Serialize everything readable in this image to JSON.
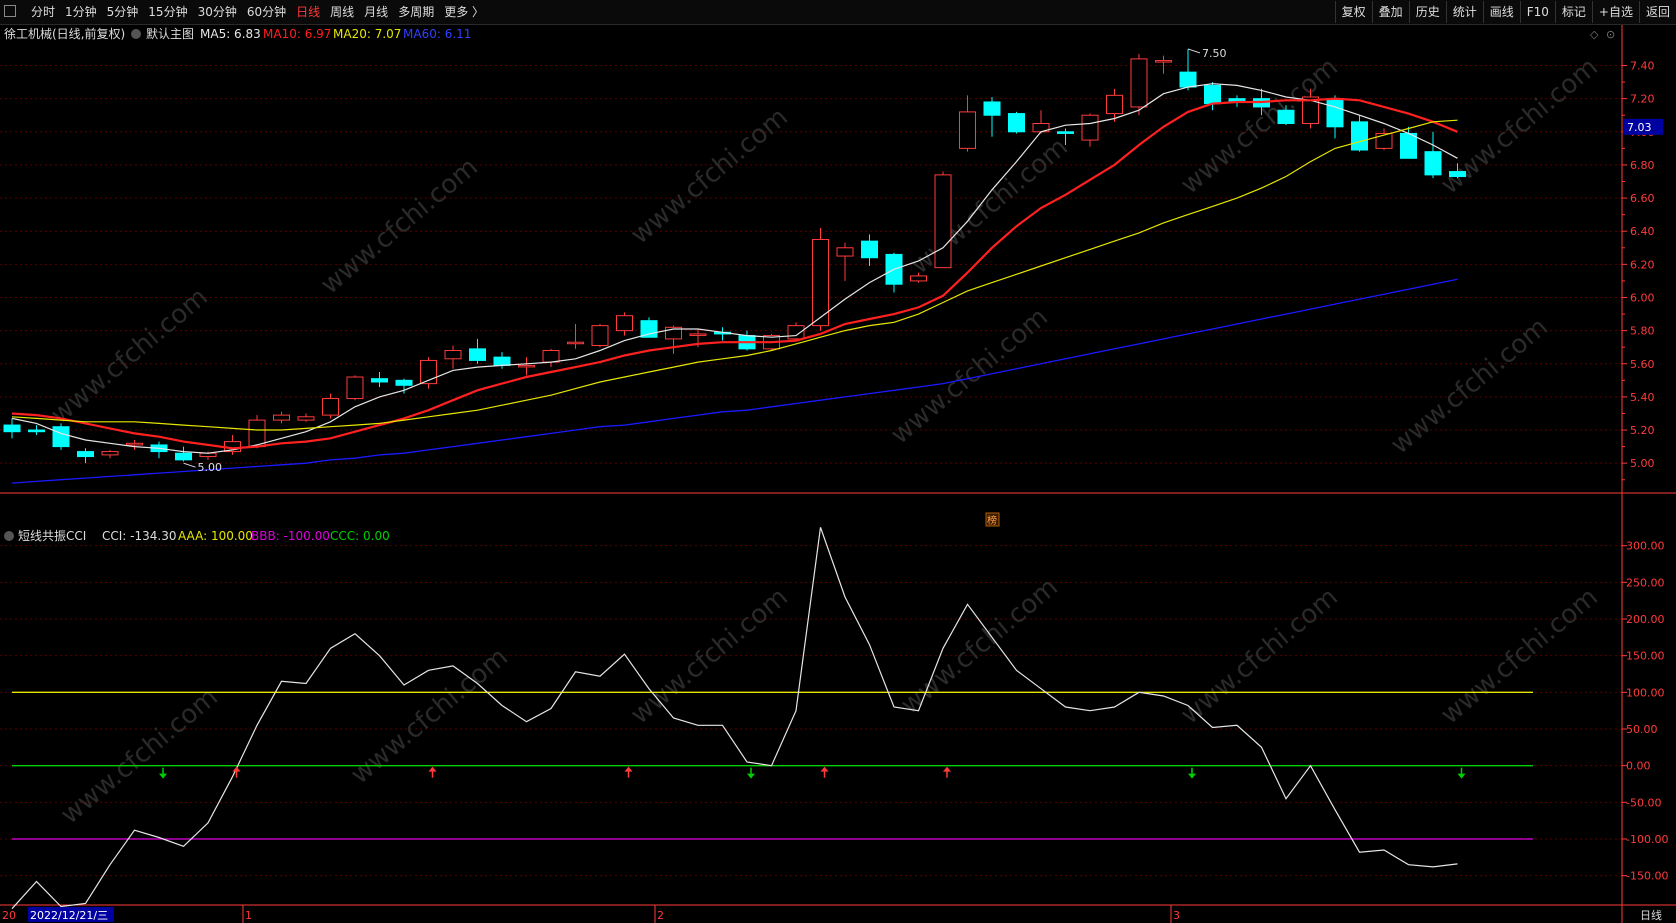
{
  "toolbar": {
    "periods": [
      "分时",
      "1分钟",
      "5分钟",
      "15分钟",
      "30分钟",
      "60分钟",
      "日线",
      "周线",
      "月线",
      "多周期",
      "更多 〉"
    ],
    "active_period": "日线",
    "tools": [
      "复权",
      "叠加",
      "历史",
      "统计",
      "画线",
      "F10",
      "标记",
      "+自选",
      "返回"
    ]
  },
  "main_header": {
    "stock": "徐工机械(日线,前复权)",
    "template": "默认主图",
    "ma5": "MA5: 6.83",
    "ma10": "MA10: 6.97",
    "ma20": "MA20: 7.07",
    "ma60": "MA60: 6.11"
  },
  "sub_header": {
    "name": "短线共振CCI",
    "cci": "CCI: -134.30",
    "aaa": "AAA: 100.00",
    "bbb": "BBB: -100.00",
    "ccc": "CCC: 0.00"
  },
  "bottom": {
    "date_label": "2022/12/21/三",
    "year_fragment": "20",
    "month_labels": [
      "1",
      "2",
      "3"
    ],
    "period_label": "日线"
  },
  "badge": "榜",
  "watermark": "www.cfchi.com",
  "colors": {
    "up": "#ff3b3b",
    "down": "#00ffff",
    "ma5": "#e6e6e6",
    "ma10": "#ff2020",
    "ma20": "#e6e600",
    "ma60": "#1a1aff",
    "cci": "#e6e6e6",
    "aaa": "#e6e600",
    "bbb": "#e000e0",
    "ccc": "#00d000",
    "grid": "#5a0000",
    "axis": "#ff3b3b"
  },
  "chart_data": [
    {
      "type": "candlestick",
      "title": "徐工机械(日线,前复权)",
      "y_ticks": [
        5.0,
        5.2,
        5.4,
        5.6,
        5.8,
        6.0,
        6.2,
        6.4,
        6.6,
        6.8,
        7.0,
        7.2,
        7.4
      ],
      "ylim": [
        4.82,
        7.56
      ],
      "last_price": "7.03",
      "high_annotation": "7.50",
      "low_annotation": "5.00",
      "candles": [
        {
          "o": 5.23,
          "h": 5.27,
          "l": 5.15,
          "c": 5.19
        },
        {
          "o": 5.2,
          "h": 5.23,
          "l": 5.17,
          "c": 5.19
        },
        {
          "o": 5.22,
          "h": 5.24,
          "l": 5.08,
          "c": 5.1
        },
        {
          "o": 5.07,
          "h": 5.09,
          "l": 5.0,
          "c": 5.04
        },
        {
          "o": 5.05,
          "h": 5.08,
          "l": 5.03,
          "c": 5.07
        },
        {
          "o": 5.11,
          "h": 5.14,
          "l": 5.08,
          "c": 5.12
        },
        {
          "o": 5.11,
          "h": 5.13,
          "l": 5.03,
          "c": 5.07
        },
        {
          "o": 5.06,
          "h": 5.1,
          "l": 5.01,
          "c": 5.02
        },
        {
          "o": 5.04,
          "h": 5.07,
          "l": 5.02,
          "c": 5.06
        },
        {
          "o": 5.07,
          "h": 5.17,
          "l": 5.05,
          "c": 5.13
        },
        {
          "o": 5.1,
          "h": 5.29,
          "l": 5.09,
          "c": 5.26
        },
        {
          "o": 5.26,
          "h": 5.31,
          "l": 5.24,
          "c": 5.29
        },
        {
          "o": 5.26,
          "h": 5.3,
          "l": 5.25,
          "c": 5.28
        },
        {
          "o": 5.29,
          "h": 5.42,
          "l": 5.27,
          "c": 5.39
        },
        {
          "o": 5.39,
          "h": 5.53,
          "l": 5.38,
          "c": 5.52
        },
        {
          "o": 5.51,
          "h": 5.55,
          "l": 5.46,
          "c": 5.49
        },
        {
          "o": 5.5,
          "h": 5.51,
          "l": 5.42,
          "c": 5.47
        },
        {
          "o": 5.48,
          "h": 5.64,
          "l": 5.45,
          "c": 5.62
        },
        {
          "o": 5.63,
          "h": 5.71,
          "l": 5.57,
          "c": 5.68
        },
        {
          "o": 5.69,
          "h": 5.75,
          "l": 5.6,
          "c": 5.62
        },
        {
          "o": 5.64,
          "h": 5.67,
          "l": 5.57,
          "c": 5.59
        },
        {
          "o": 5.59,
          "h": 5.64,
          "l": 5.53,
          "c": 5.59
        },
        {
          "o": 5.61,
          "h": 5.69,
          "l": 5.58,
          "c": 5.68
        },
        {
          "o": 5.73,
          "h": 5.84,
          "l": 5.69,
          "c": 5.73
        },
        {
          "o": 5.71,
          "h": 5.84,
          "l": 5.7,
          "c": 5.83
        },
        {
          "o": 5.8,
          "h": 5.91,
          "l": 5.77,
          "c": 5.89
        },
        {
          "o": 5.86,
          "h": 5.88,
          "l": 5.76,
          "c": 5.76
        },
        {
          "o": 5.75,
          "h": 5.83,
          "l": 5.66,
          "c": 5.82
        },
        {
          "o": 5.78,
          "h": 5.81,
          "l": 5.7,
          "c": 5.78
        },
        {
          "o": 5.79,
          "h": 5.82,
          "l": 5.74,
          "c": 5.78
        },
        {
          "o": 5.77,
          "h": 5.8,
          "l": 5.68,
          "c": 5.69
        },
        {
          "o": 5.69,
          "h": 5.78,
          "l": 5.68,
          "c": 5.77
        },
        {
          "o": 5.75,
          "h": 5.85,
          "l": 5.74,
          "c": 5.83
        },
        {
          "o": 5.83,
          "h": 6.42,
          "l": 5.8,
          "c": 6.35
        },
        {
          "o": 6.25,
          "h": 6.33,
          "l": 6.1,
          "c": 6.3
        },
        {
          "o": 6.34,
          "h": 6.38,
          "l": 6.19,
          "c": 6.24
        },
        {
          "o": 6.26,
          "h": 6.27,
          "l": 6.03,
          "c": 6.08
        },
        {
          "o": 6.1,
          "h": 6.15,
          "l": 6.09,
          "c": 6.13
        },
        {
          "o": 6.18,
          "h": 6.76,
          "l": 6.18,
          "c": 6.74
        },
        {
          "o": 6.9,
          "h": 7.22,
          "l": 6.88,
          "c": 7.12
        },
        {
          "o": 7.18,
          "h": 7.21,
          "l": 6.97,
          "c": 7.1
        },
        {
          "o": 7.11,
          "h": 7.12,
          "l": 6.99,
          "c": 7.0
        },
        {
          "o": 7.0,
          "h": 7.13,
          "l": 6.99,
          "c": 7.05
        },
        {
          "o": 7.0,
          "h": 7.02,
          "l": 6.92,
          "c": 6.99
        },
        {
          "o": 6.95,
          "h": 7.11,
          "l": 6.91,
          "c": 7.1
        },
        {
          "o": 7.11,
          "h": 7.26,
          "l": 7.06,
          "c": 7.22
        },
        {
          "o": 7.15,
          "h": 7.47,
          "l": 7.1,
          "c": 7.44
        },
        {
          "o": 7.43,
          "h": 7.46,
          "l": 7.35,
          "c": 7.43
        },
        {
          "o": 7.36,
          "h": 7.5,
          "l": 7.25,
          "c": 7.27
        },
        {
          "o": 7.28,
          "h": 7.3,
          "l": 7.13,
          "c": 7.17
        },
        {
          "o": 7.2,
          "h": 7.22,
          "l": 7.15,
          "c": 7.18
        },
        {
          "o": 7.2,
          "h": 7.26,
          "l": 7.1,
          "c": 7.15
        },
        {
          "o": 7.13,
          "h": 7.16,
          "l": 7.04,
          "c": 7.05
        },
        {
          "o": 7.05,
          "h": 7.26,
          "l": 7.02,
          "c": 7.21
        },
        {
          "o": 7.2,
          "h": 7.22,
          "l": 6.96,
          "c": 7.03
        },
        {
          "o": 7.06,
          "h": 7.1,
          "l": 6.88,
          "c": 6.89
        },
        {
          "o": 6.9,
          "h": 7.02,
          "l": 6.89,
          "c": 6.99
        },
        {
          "o": 6.99,
          "h": 7.03,
          "l": 6.84,
          "c": 6.84
        },
        {
          "o": 6.88,
          "h": 7.0,
          "l": 6.72,
          "c": 6.74
        },
        {
          "o": 6.76,
          "h": 6.81,
          "l": 6.72,
          "c": 6.73
        }
      ],
      "series": [
        {
          "name": "MA5",
          "values": [
            5.27,
            5.24,
            5.18,
            5.14,
            5.12,
            5.1,
            5.09,
            5.07,
            5.06,
            5.08,
            5.11,
            5.15,
            5.19,
            5.25,
            5.34,
            5.4,
            5.44,
            5.5,
            5.56,
            5.58,
            5.59,
            5.6,
            5.61,
            5.63,
            5.68,
            5.74,
            5.78,
            5.81,
            5.81,
            5.79,
            5.77,
            5.76,
            5.77,
            5.88,
            5.99,
            6.09,
            6.17,
            6.22,
            6.3,
            6.46,
            6.65,
            6.82,
            7.0,
            7.04,
            7.05,
            7.08,
            7.13,
            7.23,
            7.27,
            7.29,
            7.28,
            7.25,
            7.21,
            7.19,
            7.15,
            7.1,
            7.05,
            6.99,
            6.92,
            6.84
          ]
        },
        {
          "name": "MA10",
          "values": [
            5.3,
            5.29,
            5.27,
            5.24,
            5.21,
            5.18,
            5.16,
            5.13,
            5.11,
            5.09,
            5.1,
            5.12,
            5.13,
            5.15,
            5.19,
            5.23,
            5.27,
            5.32,
            5.38,
            5.44,
            5.48,
            5.52,
            5.55,
            5.58,
            5.61,
            5.65,
            5.68,
            5.7,
            5.72,
            5.73,
            5.73,
            5.73,
            5.74,
            5.78,
            5.84,
            5.87,
            5.9,
            5.94,
            6.01,
            6.15,
            6.3,
            6.43,
            6.54,
            6.62,
            6.71,
            6.8,
            6.92,
            7.03,
            7.12,
            7.17,
            7.18,
            7.18,
            7.19,
            7.19,
            7.2,
            7.19,
            7.15,
            7.11,
            7.06,
            7.0
          ]
        },
        {
          "name": "MA20",
          "values": [
            5.28,
            5.27,
            5.26,
            5.25,
            5.25,
            5.25,
            5.24,
            5.23,
            5.22,
            5.21,
            5.2,
            5.2,
            5.21,
            5.22,
            5.23,
            5.24,
            5.26,
            5.28,
            5.3,
            5.32,
            5.35,
            5.38,
            5.41,
            5.45,
            5.49,
            5.52,
            5.55,
            5.58,
            5.61,
            5.63,
            5.65,
            5.68,
            5.72,
            5.76,
            5.8,
            5.83,
            5.85,
            5.9,
            5.97,
            6.04,
            6.09,
            6.14,
            6.19,
            6.24,
            6.29,
            6.34,
            6.39,
            6.45,
            6.5,
            6.55,
            6.6,
            6.66,
            6.73,
            6.82,
            6.9,
            6.94,
            6.98,
            7.02,
            7.06,
            7.07
          ]
        },
        {
          "name": "MA60",
          "values": [
            4.88,
            4.89,
            4.9,
            4.91,
            4.92,
            4.93,
            4.94,
            4.95,
            4.96,
            4.97,
            4.98,
            4.99,
            5.0,
            5.02,
            5.03,
            5.05,
            5.06,
            5.08,
            5.1,
            5.12,
            5.14,
            5.16,
            5.18,
            5.2,
            5.22,
            5.23,
            5.25,
            5.27,
            5.29,
            5.31,
            5.32,
            5.34,
            5.36,
            5.38,
            5.4,
            5.42,
            5.44,
            5.46,
            5.48,
            5.51,
            5.54,
            5.57,
            5.6,
            5.63,
            5.66,
            5.69,
            5.72,
            5.75,
            5.78,
            5.81,
            5.84,
            5.87,
            5.9,
            5.93,
            5.96,
            5.99,
            6.02,
            6.05,
            6.08,
            6.11
          ]
        }
      ]
    },
    {
      "type": "line",
      "title": "短线共振CCI",
      "y_ticks": [
        -150,
        -100,
        -50,
        0,
        50,
        100,
        150,
        200,
        250,
        300
      ],
      "y_tick_labels": [
        "-150.00",
        "-100.00",
        "-50.00",
        "0.00",
        "50.00",
        "100.00",
        "150.00",
        "200.00",
        "250.00",
        "300.00"
      ],
      "ylim": [
        -190,
        350
      ],
      "series": [
        {
          "name": "CCI",
          "values": [
            -195,
            -158,
            -192,
            -188,
            -135,
            -88,
            -98,
            -110,
            -78,
            -15,
            55,
            115,
            112,
            160,
            180,
            150,
            110,
            130,
            136,
            112,
            82,
            60,
            78,
            128,
            122,
            152,
            105,
            65,
            55,
            55,
            5,
            0,
            75,
            325,
            230,
            165,
            80,
            75,
            160,
            220,
            175,
            130,
            105,
            80,
            75,
            80,
            100,
            95,
            82,
            52,
            55,
            25,
            -45,
            0,
            -60,
            -118,
            -115,
            -135,
            -138,
            -134
          ]
        },
        {
          "name": "AAA",
          "value": 100
        },
        {
          "name": "BBB",
          "value": -100
        },
        {
          "name": "CCC",
          "value": 0
        }
      ],
      "signals": [
        {
          "index": 6,
          "dir": "down"
        },
        {
          "index": 9,
          "dir": "up"
        },
        {
          "index": 17,
          "dir": "up"
        },
        {
          "index": 25,
          "dir": "up"
        },
        {
          "index": 30,
          "dir": "down"
        },
        {
          "index": 33,
          "dir": "up"
        },
        {
          "index": 38,
          "dir": "up"
        },
        {
          "index": 48,
          "dir": "down"
        },
        {
          "index": 59,
          "dir": "down"
        }
      ]
    }
  ]
}
